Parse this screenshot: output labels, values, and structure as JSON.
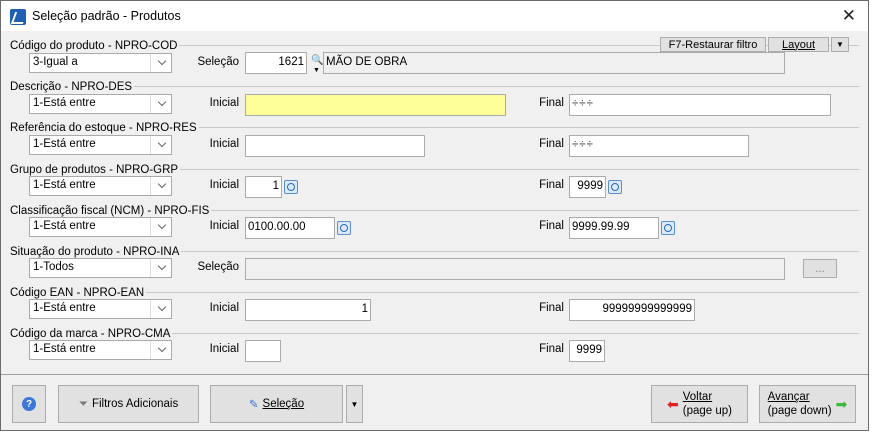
{
  "window": {
    "title": "Seleção padrão - Produtos"
  },
  "toolbar": {
    "restore_filter": "F7-Restaurar filtro",
    "layout": "Layout"
  },
  "sections": [
    {
      "title": "Código do produto - NPRO-COD",
      "operator": "3-Igual a",
      "label1": "Seleção",
      "value1": "1621",
      "description": "MÃO DE OBRA"
    },
    {
      "title": "Descrição - NPRO-DES",
      "operator": "1-Está entre",
      "label1": "Inicial",
      "value1": "",
      "label2": "Final",
      "value2": "÷÷÷"
    },
    {
      "title": "Referência do estoque - NPRO-RES",
      "operator": "1-Está entre",
      "label1": "Inicial",
      "value1": "",
      "label2": "Final",
      "value2": "÷÷÷"
    },
    {
      "title": "Grupo de produtos - NPRO-GRP",
      "operator": "1-Está entre",
      "label1": "Inicial",
      "value1": "1",
      "label2": "Final",
      "value2": "9999"
    },
    {
      "title": "Classificação fiscal (NCM) - NPRO-FIS",
      "operator": "1-Está entre",
      "label1": "Inicial",
      "value1": "0100.00.00",
      "label2": "Final",
      "value2": "9999.99.99"
    },
    {
      "title": "Situação do produto - NPRO-INA",
      "operator": "1-Todos",
      "label1": "Seleção",
      "value1": "",
      "ellipsis": "..."
    },
    {
      "title": "Código EAN - NPRO-EAN",
      "operator": "1-Está entre",
      "label1": "Inicial",
      "value1": "1",
      "label2": "Final",
      "value2": "99999999999999"
    },
    {
      "title": "Código da marca - NPRO-CMA",
      "operator": "1-Está entre",
      "label1": "Inicial",
      "value1": "",
      "label2": "Final",
      "value2": "9999"
    }
  ],
  "footer": {
    "filters": "Filtros Adicionais",
    "selection": "Seleção",
    "back": "Voltar",
    "back_sub": "(page up)",
    "next": "Avançar",
    "next_sub": "(page down)"
  },
  "colors": {
    "highlight": "#ffff99"
  }
}
